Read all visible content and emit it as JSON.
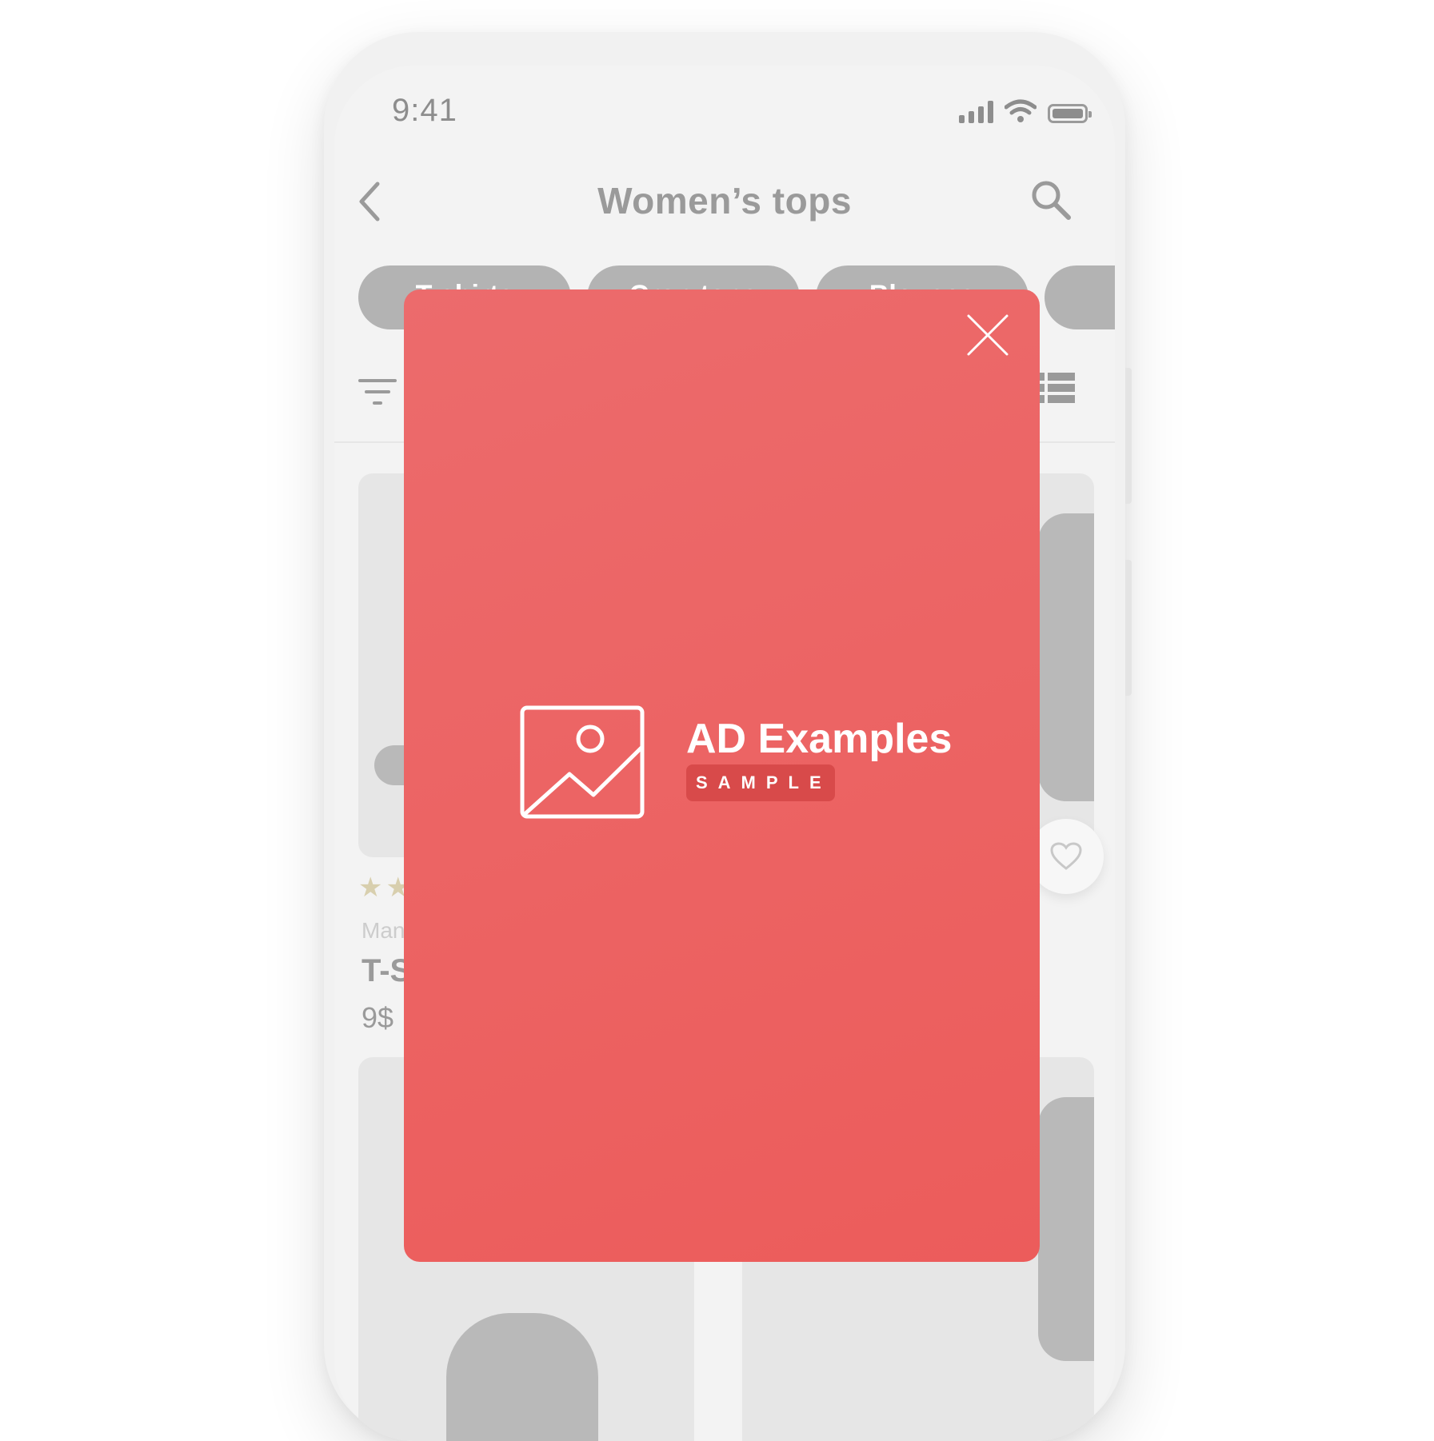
{
  "status_bar": {
    "time": "9:41",
    "icons": [
      "cellular-signal-icon",
      "wifi-icon",
      "battery-icon"
    ]
  },
  "header": {
    "title": "Women’s tops",
    "back_icon": "chevron-left-icon",
    "search_icon": "search-icon"
  },
  "categories": [
    "T-shirts",
    "Crop tops",
    "Blouses",
    ""
  ],
  "toolbar": {
    "filter_icon": "filter-icon",
    "view_icon": "list-view-icon"
  },
  "products": [
    {
      "brand": "Mango",
      "name": "T-Shirt",
      "price": "9$",
      "rating": "★★",
      "favorite_icon": "heart-icon"
    }
  ],
  "ad": {
    "title": "AD Examples",
    "badge": "SAMPLE",
    "close_icon": "close-icon",
    "placeholder_icon": "image-placeholder-icon",
    "colors": {
      "background_top": "#ec6b6c",
      "background_bottom": "#ec5c5b",
      "badge": "#d84a4a"
    }
  },
  "colors": {
    "screen_background": "#f3f3f3",
    "chip_background": "#b3b3b3",
    "muted_text": "#9a9a9a"
  }
}
